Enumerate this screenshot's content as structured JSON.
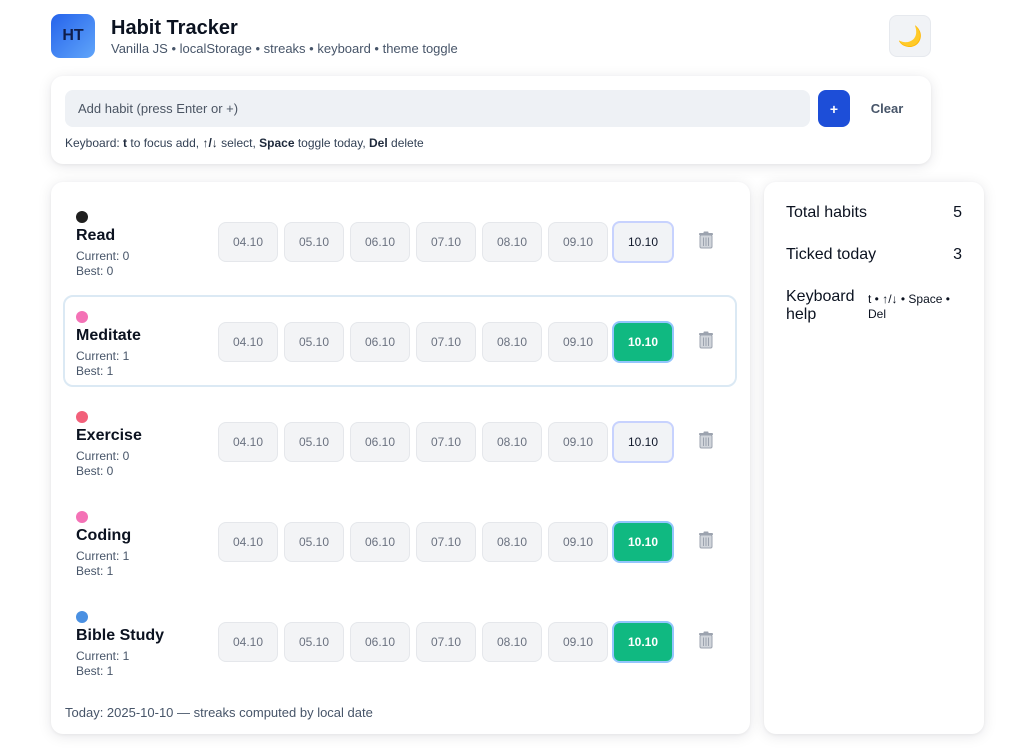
{
  "header": {
    "logo_text": "HT",
    "title": "Habit Tracker",
    "subtitle": "Vanilla JS • localStorage • streaks • keyboard • theme toggle",
    "theme_icon": "moon-icon",
    "theme_glyph": "🌙"
  },
  "add": {
    "placeholder": "Add habit (press Enter or +)",
    "add_label": "+",
    "clear_label": "Clear",
    "help": {
      "prefix": "Keyboard: ",
      "k1": "t",
      "t1": " to focus add, ",
      "k2": "↑/↓",
      "t2": " select, ",
      "k3": "Space",
      "t3": " toggle today, ",
      "k4": "Del",
      "t4": " delete"
    }
  },
  "days": [
    "04.10",
    "05.10",
    "06.10",
    "07.10",
    "08.10",
    "09.10",
    "10.10"
  ],
  "habits": [
    {
      "name": "Read",
      "color": "#1f1f1f",
      "current": "Current: 0",
      "best": "Best: 0",
      "today_done": false,
      "selected": false
    },
    {
      "name": "Meditate",
      "color": "#f472b6",
      "current": "Current: 1",
      "best": "Best: 1",
      "today_done": true,
      "selected": true
    },
    {
      "name": "Exercise",
      "color": "#f2607a",
      "current": "Current: 0",
      "best": "Best: 0",
      "today_done": false,
      "selected": false
    },
    {
      "name": "Coding",
      "color": "#f472b6",
      "current": "Current: 1",
      "best": "Best: 1",
      "today_done": true,
      "selected": false
    },
    {
      "name": "Bible Study",
      "color": "#4a90e2",
      "current": "Current: 1",
      "best": "Best: 1",
      "today_done": true,
      "selected": false
    }
  ],
  "footer": "Today: 2025-10-10 — streaks computed by local date",
  "stats": {
    "total_label": "Total habits",
    "total_value": "5",
    "today_label": "Ticked today",
    "today_value": "3",
    "help_label": "Keyboard help",
    "help_value": "t • ↑/↓ • Space • Del"
  }
}
